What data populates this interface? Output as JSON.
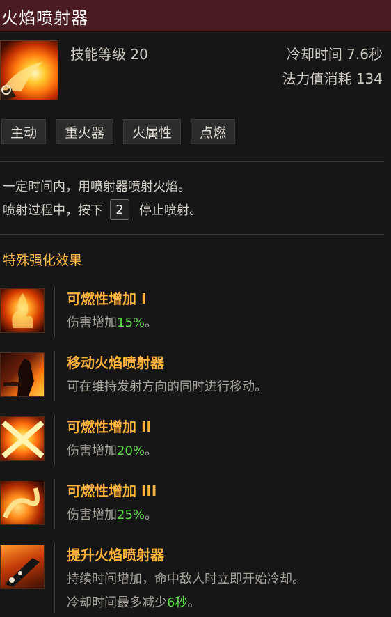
{
  "header": {
    "title": "火焰喷射器"
  },
  "skill": {
    "level_text": "技能等级 20",
    "cooldown_text": "冷却时间 7.6秒",
    "mana_text": "法力值消耗 134",
    "icon": "flamethrower-skill-icon"
  },
  "tags": [
    "主动",
    "重火器",
    "火属性",
    "点燃"
  ],
  "description": {
    "line1": "一定时间内，用喷射器喷射火焰。",
    "line2_before": "喷射过程中，按下",
    "line2_key": "2",
    "line2_after": "停止喷射。"
  },
  "special": {
    "title": "特殊强化效果",
    "effects": [
      {
        "name": "可燃性增加 I",
        "desc_prefix": "伤害增加",
        "desc_value": "15%",
        "desc_suffix": "。",
        "icon": "fire-burst-icon"
      },
      {
        "name": "移动火焰喷射器",
        "desc": "可在维持发射方向的同时进行移动。",
        "icon": "moving-gunner-icon"
      },
      {
        "name": "可燃性增加 II",
        "desc_prefix": "伤害增加",
        "desc_value": "20%",
        "desc_suffix": "。",
        "icon": "cross-flame-icon"
      },
      {
        "name": "可燃性增加 III",
        "desc_prefix": "伤害增加",
        "desc_value": "25%",
        "desc_suffix": "。",
        "icon": "flame-swirl-icon"
      },
      {
        "name": "提升火焰喷射器",
        "desc": "持续时间增加，命中敌人时立即开始冷却。",
        "desc2_prefix": "冷却时间最多减少",
        "desc2_value": "6秒",
        "desc2_suffix": "。",
        "icon": "flamethrower-weapon-icon"
      }
    ]
  },
  "colors": {
    "title_bar": "#4a1c22",
    "effect_name": "#ffb23c",
    "highlight_value": "#5ddb4a"
  }
}
